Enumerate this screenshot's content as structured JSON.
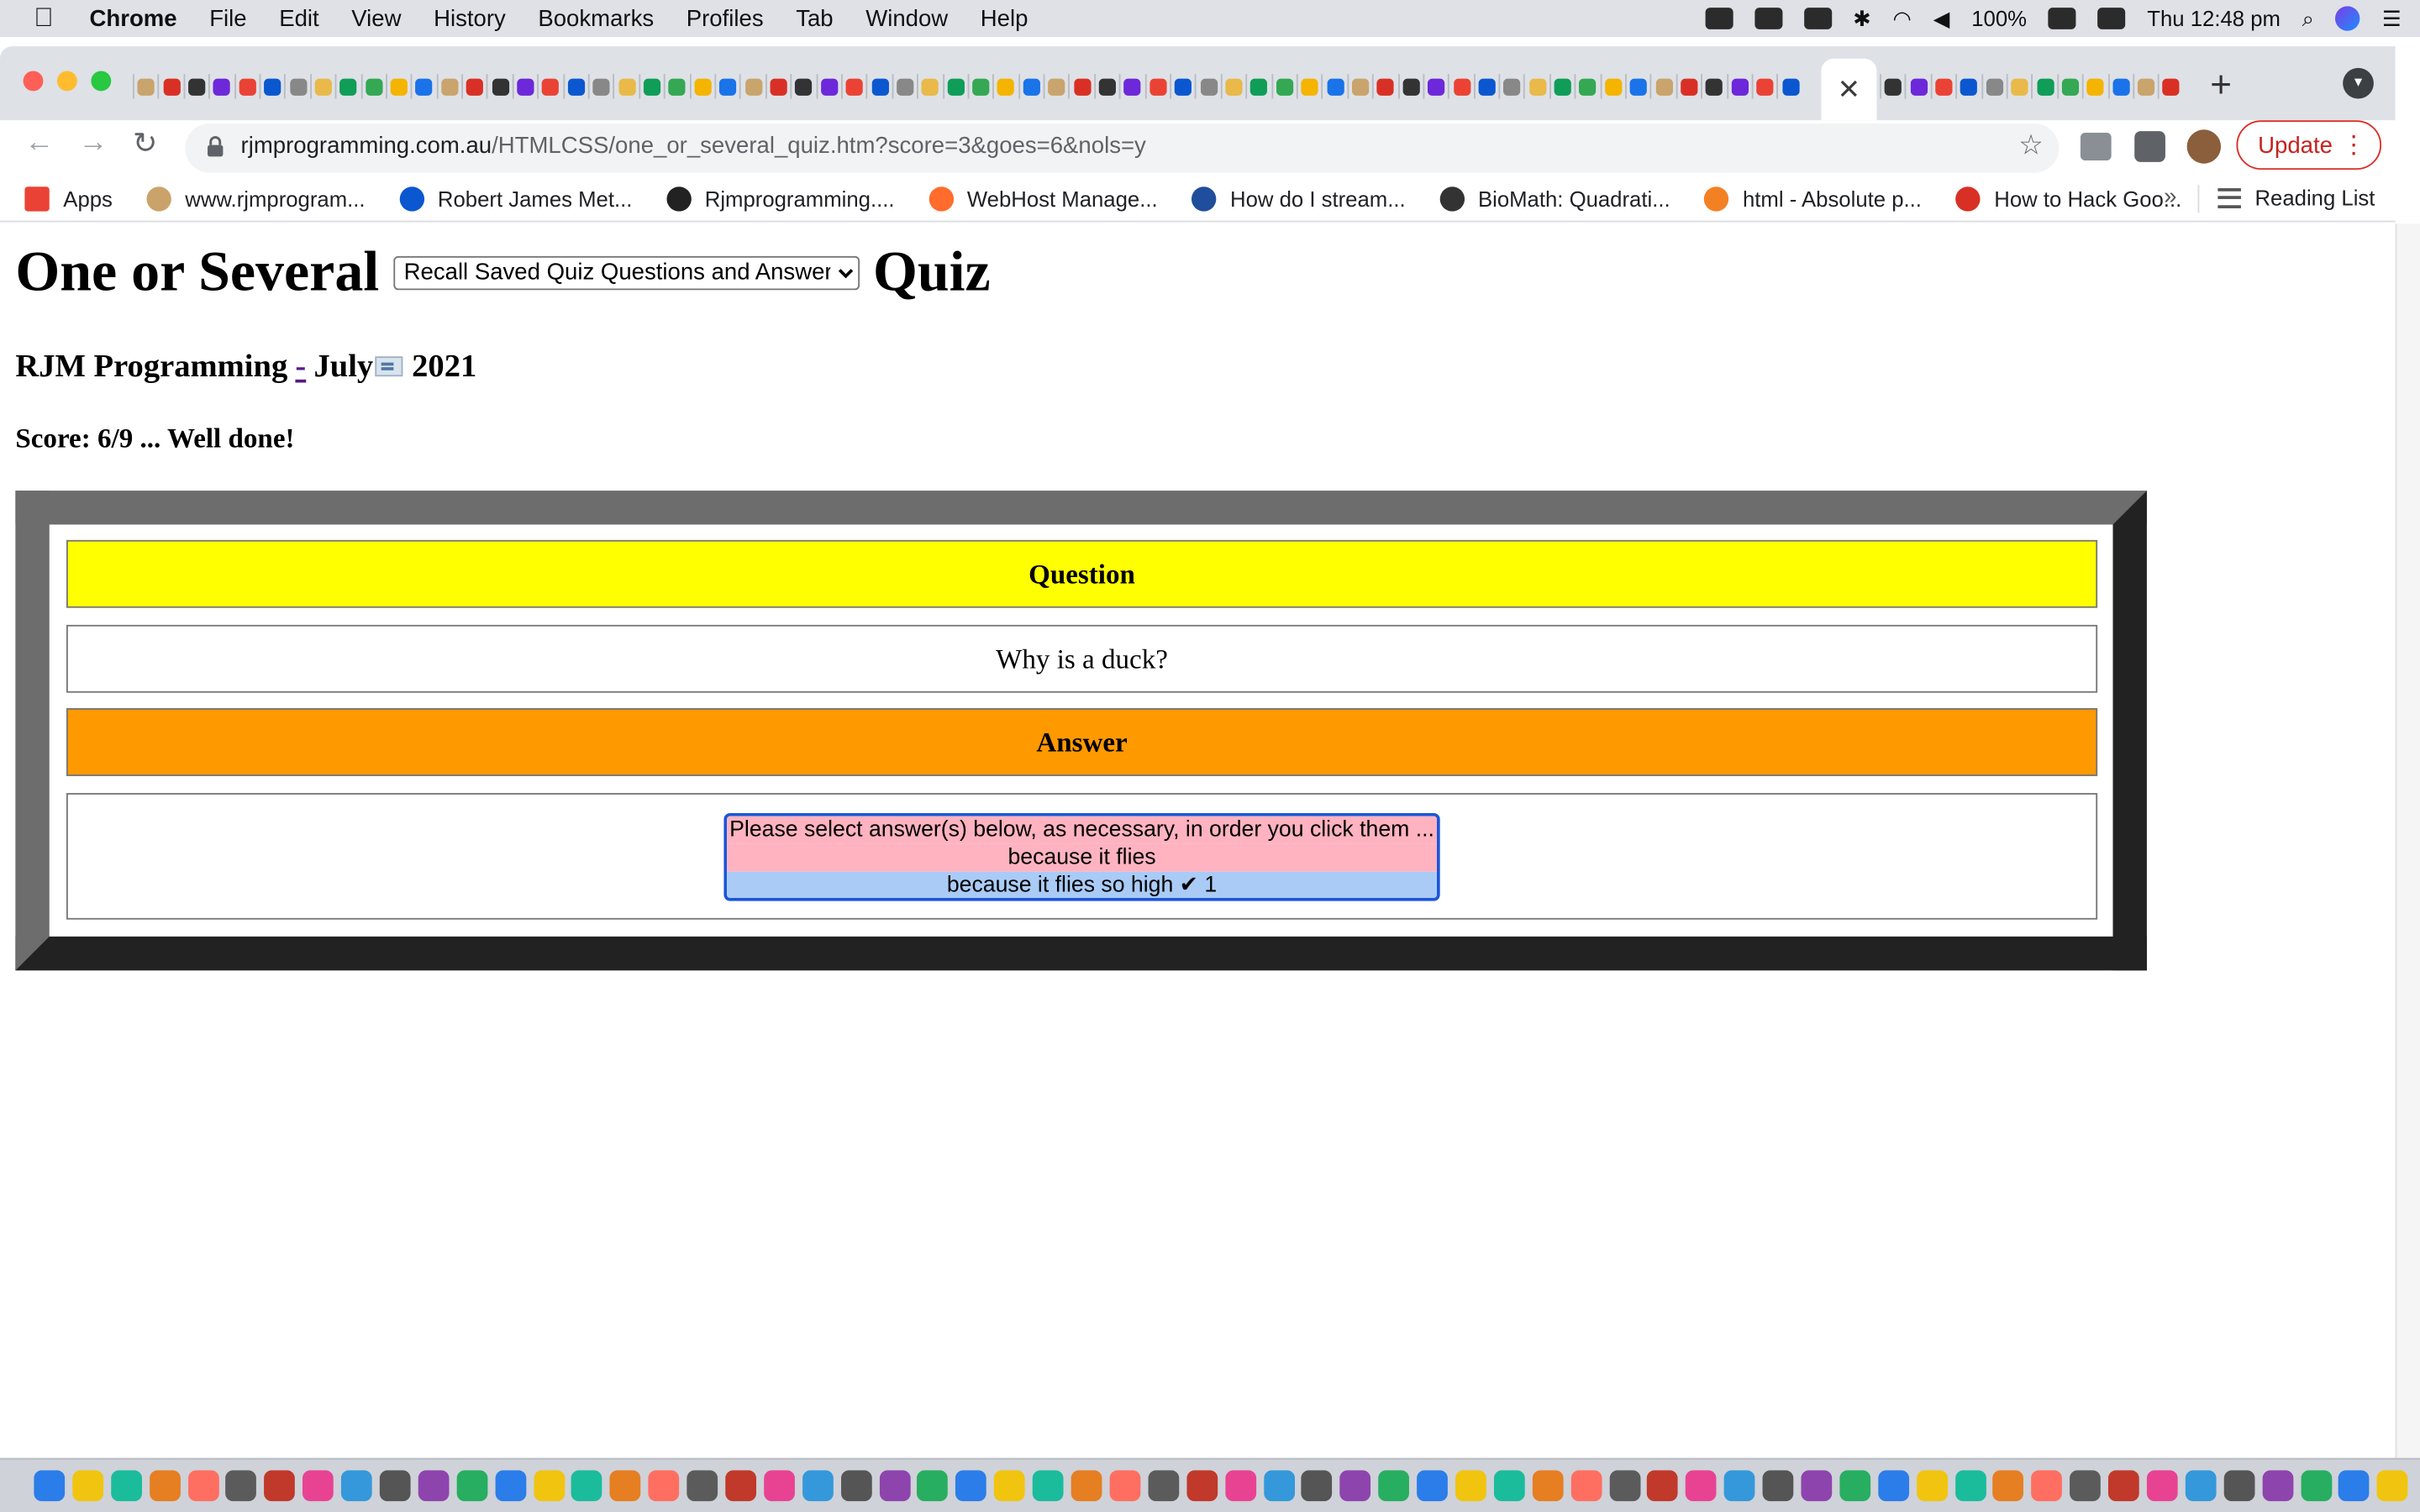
{
  "menubar": {
    "app": "Chrome",
    "items": [
      "File",
      "Edit",
      "View",
      "History",
      "Bookmarks",
      "Profiles",
      "Tab",
      "Window",
      "Help"
    ],
    "battery": "100%",
    "clock": "Thu 12:48 pm"
  },
  "tabs": {
    "close_glyph": "✕",
    "new_tab_glyph": "+"
  },
  "toolbar": {
    "url_host": "rjmprogramming.com.au",
    "url_path": "/HTMLCSS/one_or_several_quiz.htm?score=3&goes=6&nols=y",
    "update_label": "Update"
  },
  "bookmarks": {
    "items": [
      {
        "label": "Apps",
        "icon": "apps-grid-icon",
        "color": "#ea4335"
      },
      {
        "label": "www.rjmprogram...",
        "icon": "rjm-icon",
        "color": "#caa36a"
      },
      {
        "label": "Robert James Met...",
        "icon": "globe-icon",
        "color": "#0b57d0"
      },
      {
        "label": "Rjmprogramming....",
        "icon": "amazon-icon",
        "color": "#222222"
      },
      {
        "label": "WebHost Manage...",
        "icon": "cpanel-icon",
        "color": "#ff6c2c"
      },
      {
        "label": "How do I stream...",
        "icon": "vw-icon",
        "color": "#1f4e9c"
      },
      {
        "label": "BioMath: Quadrati...",
        "icon": "globe-icon",
        "color": "#333333"
      },
      {
        "label": "html - Absolute p...",
        "icon": "stackoverflow-icon",
        "color": "#f48024"
      },
      {
        "label": "How to Hack Goo...",
        "icon": "g-icon",
        "color": "#d93025"
      }
    ],
    "more": "»",
    "reading_list": "Reading List"
  },
  "page": {
    "title_left": "One or Several",
    "title_right": "Quiz",
    "select_value": "Recall Saved Quiz Questions and Answers",
    "author": "RJM Programming",
    "dash": "-",
    "month": "July",
    "year": "2021",
    "score": "Score: 6/9 ... Well done!",
    "question_header": "Question",
    "question_text": "Why is a duck?",
    "answer_header": "Answer",
    "answer_options": [
      "Please select answer(s) below, as necessary, in order you click them ...",
      "because it flies",
      "because it flies so high ✔ 1"
    ]
  },
  "colors": {
    "question_header_bg": "#ffff00",
    "answer_header_bg": "#ff9900",
    "option_pink": "#ffb3c0",
    "option_blue": "#a9cbf6",
    "update_red": "#c5221f"
  }
}
